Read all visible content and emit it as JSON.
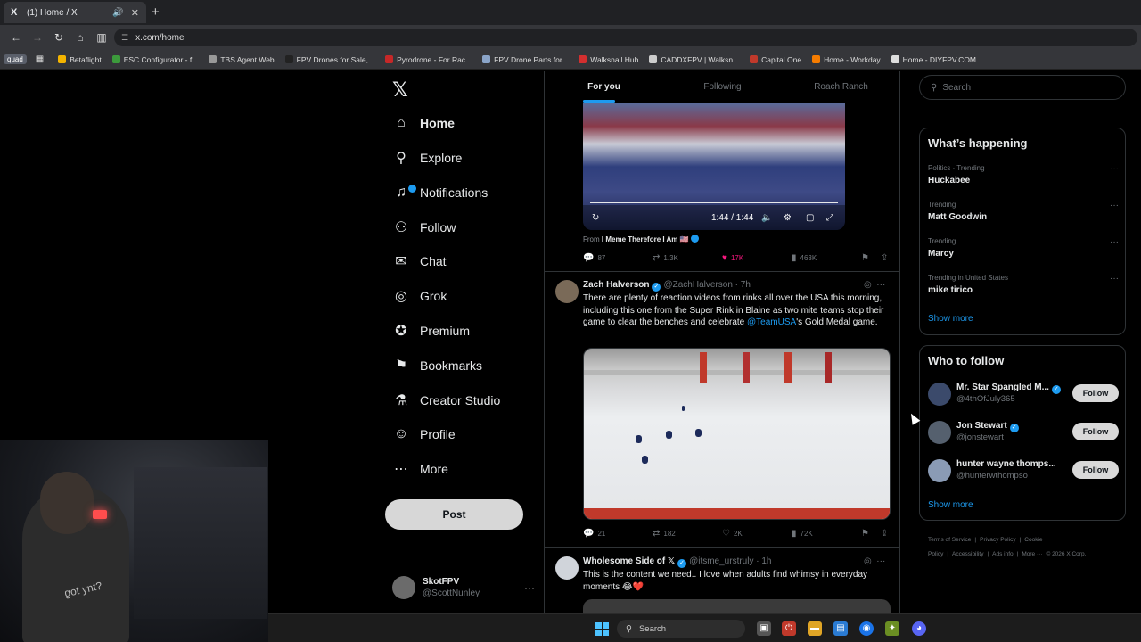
{
  "browser": {
    "tab_title": "(1) Home / X",
    "tab_favicon": "X",
    "new_tab_glyph": "+",
    "url": "x.com/home",
    "profile_badge": "quad",
    "bookmarks": [
      {
        "label": "Betaflight",
        "color": "#f4b400"
      },
      {
        "label": "ESC Configurator - f...",
        "color": "#3c9a3c"
      },
      {
        "label": "TBS Agent Web",
        "color": "#999999"
      },
      {
        "label": "FPV Drones for Sale,...",
        "color": "#222222"
      },
      {
        "label": "Pyrodrone - For Rac...",
        "color": "#c62828"
      },
      {
        "label": "FPV Drone Parts for...",
        "color": "#8aa4c8"
      },
      {
        "label": "Walksnail Hub",
        "color": "#d32f2f"
      },
      {
        "label": "CADDXFPV | Walksn...",
        "color": "#cccccc"
      },
      {
        "label": "Capital One",
        "color": "#c0392b"
      },
      {
        "label": "Home - Workday",
        "color": "#f57c00"
      },
      {
        "label": "Home - DIYFPV.COM",
        "color": "#dddddd"
      }
    ]
  },
  "nav": {
    "items": [
      {
        "label": "Home",
        "icon": "home-icon",
        "glyph": "⌂"
      },
      {
        "label": "Explore",
        "icon": "search-icon",
        "glyph": "⚲"
      },
      {
        "label": "Notifications",
        "icon": "bell-icon",
        "glyph": "♫"
      },
      {
        "label": "Follow",
        "icon": "person-plus-icon",
        "glyph": "⚇"
      },
      {
        "label": "Chat",
        "icon": "mail-icon",
        "glyph": "✉"
      },
      {
        "label": "Grok",
        "icon": "grok-icon",
        "glyph": "◎"
      },
      {
        "label": "Premium",
        "icon": "premium-icon",
        "glyph": "✪"
      },
      {
        "label": "Bookmarks",
        "icon": "bookmark-icon",
        "glyph": "⚑"
      },
      {
        "label": "Creator Studio",
        "icon": "flask-icon",
        "glyph": "⚗"
      },
      {
        "label": "Profile",
        "icon": "person-icon",
        "glyph": "☺"
      },
      {
        "label": "More",
        "icon": "more-icon",
        "glyph": "⋯"
      }
    ],
    "post_label": "Post",
    "account_name": "SkotFPV",
    "account_handle": "@ScottNunley"
  },
  "feed": {
    "tabs": [
      "For you",
      "Following",
      "Roach Ranch"
    ],
    "tweet1": {
      "video_time": "1:44 / 1:44",
      "from_prefix": "From",
      "from_name": "I Meme Therefore I Am 🇺🇸",
      "replies": "87",
      "reposts": "1.3K",
      "likes": "17K",
      "views": "463K"
    },
    "tweet2": {
      "name": "Zach Halverson",
      "handle": "@ZachHalverson · 7h",
      "text_pre": "There are plenty of reaction videos from rinks all over the USA this morning, including this one from the Super Rink in Blaine as two mite teams stop their game to clear the benches and celebrate ",
      "text_link": "@TeamUSA",
      "text_post": "'s Gold Medal game.",
      "replies": "21",
      "reposts": "182",
      "likes": "2K",
      "views": "72K"
    },
    "tweet3": {
      "name": "Wholesome Side of 𝕏",
      "handle": "@itsme_urstruly · 1h",
      "text": "This is the content we need.. I love when adults find whimsy in everyday moments 😂❤️"
    }
  },
  "sidebar": {
    "search_placeholder": "Search",
    "happening_title": "What’s happening",
    "trends": [
      {
        "category": "Politics · Trending",
        "title": "Huckabee"
      },
      {
        "category": "Trending",
        "title": "Matt Goodwin"
      },
      {
        "category": "Trending",
        "title": "Marcy"
      },
      {
        "category": "Trending in United States",
        "title": "mike tirico"
      }
    ],
    "show_more": "Show more",
    "who_title": "Who to follow",
    "who": [
      {
        "name": "Mr. Star Spangled M...",
        "handle": "@4thOfJuly365",
        "follow": "Follow"
      },
      {
        "name": "Jon Stewart",
        "handle": "@jonstewart",
        "follow": "Follow"
      },
      {
        "name": "hunter wayne thomps...",
        "handle": "@hunterwthompso",
        "follow": "Follow"
      }
    ],
    "footer": [
      "Terms of Service",
      "|",
      "Privacy Policy",
      "|",
      "Cookie Policy",
      "|",
      "Accessibility",
      "|",
      "Ads info",
      "|",
      "More ···",
      "© 2026 X Corp."
    ]
  },
  "webcam": {
    "shirt_text": "got ynt?"
  },
  "taskbar": {
    "search_label": "Search"
  }
}
